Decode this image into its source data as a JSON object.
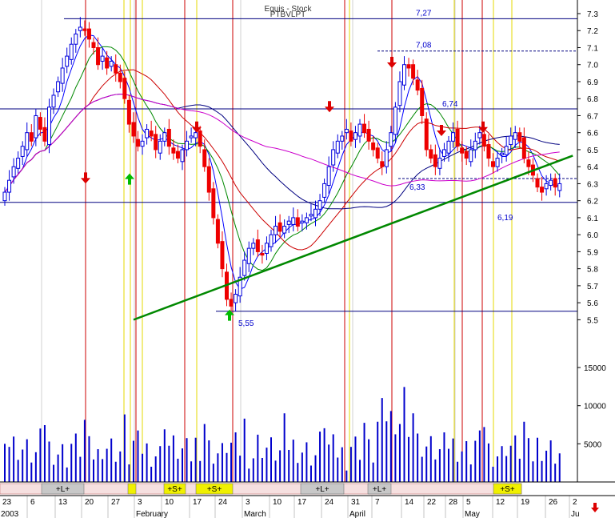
{
  "chart_data": {
    "type": "candlestick",
    "title_line1": "Equis - Stock",
    "title_line2": "PTBVLPT",
    "price_axis": {
      "ticks": [
        "7.3",
        "7.2",
        "7.1",
        "7.0",
        "6.9",
        "6.8",
        "6.7",
        "6.6",
        "6.5",
        "6.4",
        "6.3",
        "6.2",
        "6.1",
        "6.0",
        "5.9",
        "5.8",
        "5.7",
        "5.6",
        "5.5"
      ],
      "ylim": [
        5.45,
        7.38
      ]
    },
    "volume_axis": {
      "ticks": [
        "15000",
        "10000",
        "5000"
      ],
      "ylim": [
        0,
        17000
      ]
    },
    "date_labels": [
      {
        "top": "23",
        "bottom": "2003"
      },
      {
        "top": "6",
        "bottom": ""
      },
      {
        "top": "13",
        "bottom": ""
      },
      {
        "top": "20",
        "bottom": ""
      },
      {
        "top": "27",
        "bottom": ""
      },
      {
        "top": "3",
        "bottom": "February"
      },
      {
        "top": "10",
        "bottom": ""
      },
      {
        "top": "17",
        "bottom": ""
      },
      {
        "top": "24",
        "bottom": ""
      },
      {
        "top": "3",
        "bottom": "March"
      },
      {
        "top": "10",
        "bottom": ""
      },
      {
        "top": "17",
        "bottom": ""
      },
      {
        "top": "24",
        "bottom": ""
      },
      {
        "top": "31",
        "bottom": "April"
      },
      {
        "top": "7",
        "bottom": ""
      },
      {
        "top": "14",
        "bottom": ""
      },
      {
        "top": "22",
        "bottom": ""
      },
      {
        "top": "28",
        "bottom": ""
      },
      {
        "top": "5",
        "bottom": "May"
      },
      {
        "top": "12",
        "bottom": ""
      },
      {
        "top": "19",
        "bottom": ""
      },
      {
        "top": "26",
        "bottom": ""
      },
      {
        "top": "2",
        "bottom": "Ju"
      }
    ],
    "annotations": [
      {
        "text": "7,27",
        "price": 7.27
      },
      {
        "text": "7,08",
        "price": 7.08
      },
      {
        "text": "6,74",
        "price": 6.74
      },
      {
        "text": "6,33",
        "price": 6.33
      },
      {
        "text": "6,19",
        "price": 6.19
      },
      {
        "text": "5,55",
        "price": 5.55
      }
    ],
    "horizontal_levels": [
      7.27,
      7.08,
      6.74,
      6.33,
      6.19,
      5.55
    ],
    "trendline": {
      "from_bar": 29,
      "from_price": 5.5,
      "to_bar": 124,
      "to_price": 6.38
    },
    "signal_bands": [
      "+L+",
      "+S+",
      "+S+",
      "+L+",
      "+L+",
      "+S+"
    ],
    "close": [
      6.25,
      6.32,
      6.4,
      6.45,
      6.52,
      6.6,
      6.55,
      6.7,
      6.62,
      6.55,
      6.75,
      6.82,
      6.9,
      6.98,
      7.05,
      7.12,
      7.18,
      7.22,
      7.2,
      7.15,
      7.1,
      7.0,
      7.05,
      6.98,
      7.02,
      6.95,
      6.9,
      6.8,
      6.65,
      6.58,
      6.52,
      6.55,
      6.62,
      6.58,
      6.5,
      6.55,
      6.6,
      6.52,
      6.48,
      6.45,
      6.5,
      6.55,
      6.58,
      6.6,
      6.52,
      6.4,
      6.25,
      6.1,
      5.95,
      5.8,
      5.62,
      5.58,
      5.65,
      5.75,
      5.85,
      5.92,
      5.95,
      5.9,
      5.88,
      5.95,
      6.0,
      6.05,
      6.02,
      6.05,
      6.08,
      6.1,
      6.05,
      6.08,
      6.1,
      6.12,
      6.15,
      6.2,
      6.3,
      6.4,
      6.5,
      6.55,
      6.58,
      6.62,
      6.55,
      6.6,
      6.65,
      6.6,
      6.55,
      6.5,
      6.45,
      6.4,
      6.5,
      6.6,
      6.75,
      6.9,
      7.0,
      6.98,
      6.92,
      6.85,
      6.7,
      6.5,
      6.45,
      6.4,
      6.45,
      6.5,
      6.55,
      6.6,
      6.52,
      6.48,
      6.45,
      6.5,
      6.55,
      6.6,
      6.52,
      6.45,
      6.4,
      6.45,
      6.48,
      6.52,
      6.58,
      6.6,
      6.55,
      6.45,
      6.4,
      6.35,
      6.28,
      6.25,
      6.3,
      6.32,
      6.28,
      6.3
    ]
  },
  "colors": {
    "up": "#0000dd",
    "down": "#ee0000",
    "ma_green": "#008800",
    "ma_red": "#cc0000",
    "ma_navy": "#000080",
    "ma_magenta": "#cc00cc",
    "ma_blue": "#0000ff",
    "trend": "#008800"
  }
}
